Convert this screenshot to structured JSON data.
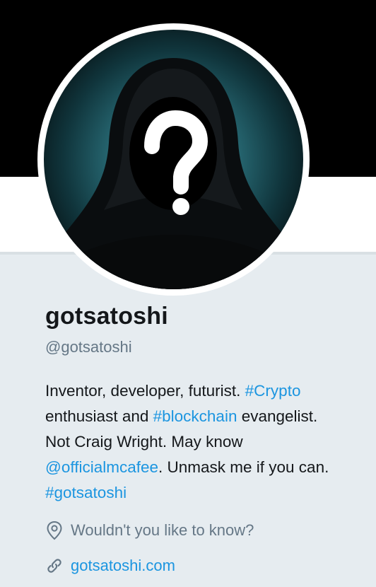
{
  "profile": {
    "name": "gotsatoshi",
    "handle": "@gotsatoshi",
    "avatar_icon": "hooded-figure-question-mark",
    "bio": {
      "line1_text": "Inventor, developer, futurist. ",
      "line1_hashtag": "#Crypto",
      "line2_text_a": "enthusiast and ",
      "line2_hashtag": "#blockchain",
      "line2_text_b": " evangelist.",
      "line3_text": "Not Craig Wright. May know",
      "line4_mention": "@officialmcafee",
      "line4_text": ". Unmask me if you can.",
      "line5_hashtag": "#gotsatoshi"
    },
    "location": "Wouldn't you like to know?",
    "website": "gotsatoshi.com"
  },
  "colors": {
    "link": "#1b95e0",
    "secondary_text": "#657786",
    "background": "#e6ecf0",
    "banner": "#000000"
  }
}
